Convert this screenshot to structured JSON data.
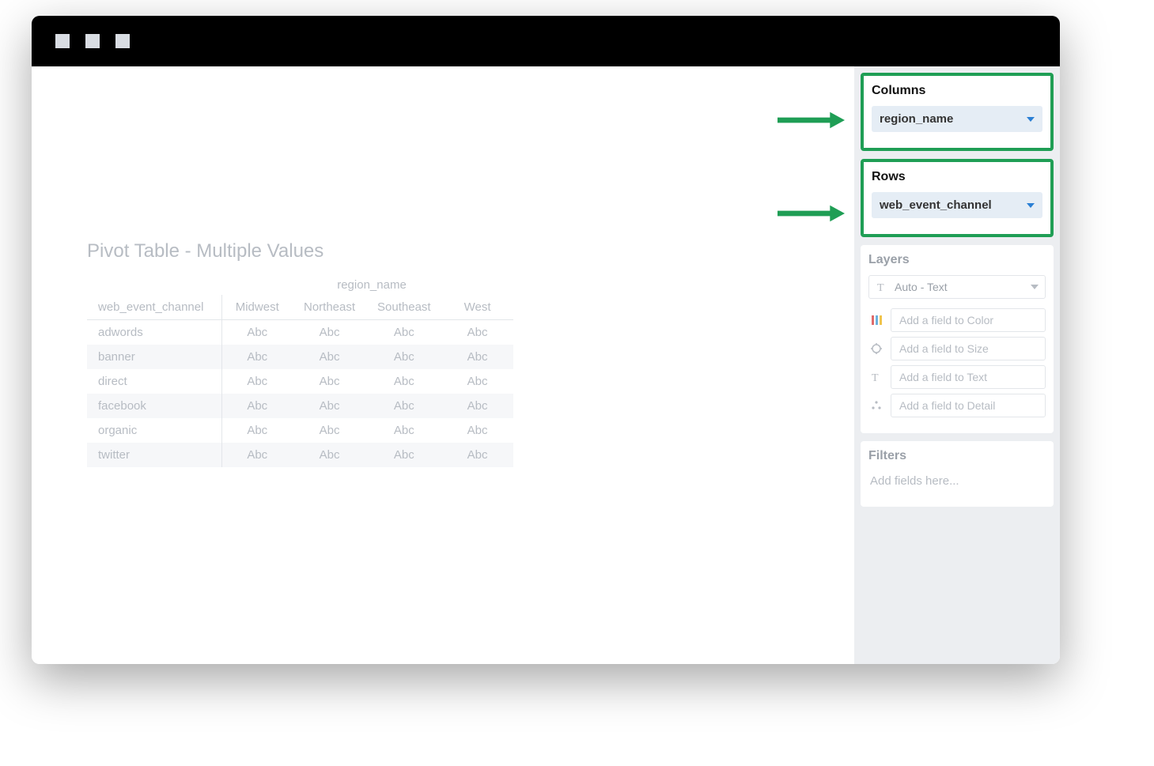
{
  "pivot": {
    "title": "Pivot Table - Multiple Values",
    "col_super": "region_name",
    "row_header": "web_event_channel",
    "columns": [
      "Midwest",
      "Northeast",
      "Southeast",
      "West"
    ],
    "rows": [
      "adwords",
      "banner",
      "direct",
      "facebook",
      "organic",
      "twitter"
    ],
    "cell_placeholder": "Abc"
  },
  "sidebar": {
    "columns": {
      "title": "Columns",
      "pill": "region_name"
    },
    "rows": {
      "title": "Rows",
      "pill": "web_event_channel"
    },
    "layers": {
      "title": "Layers",
      "type_label": "Auto - Text",
      "color": "Add a field to Color",
      "size": "Add a field to Size",
      "text": "Add a field to Text",
      "detail": "Add a field to Detail"
    },
    "filters": {
      "title": "Filters",
      "placeholder": "Add fields here..."
    }
  }
}
